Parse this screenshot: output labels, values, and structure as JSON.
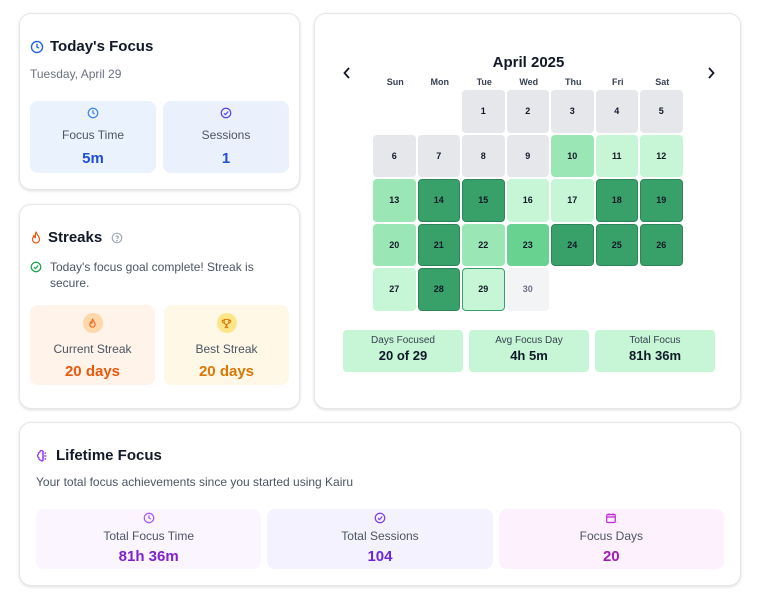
{
  "today": {
    "title": "Today's Focus",
    "date": "Tuesday, April 29",
    "focus_time_label": "Focus Time",
    "focus_time_value": "5m",
    "sessions_label": "Sessions",
    "sessions_value": "1"
  },
  "streaks": {
    "title": "Streaks",
    "status_text": "Today's focus goal complete! Streak is secure.",
    "current_label": "Current Streak",
    "current_value": "20 days",
    "best_label": "Best Streak",
    "best_value": "20 days"
  },
  "calendar": {
    "title": "April 2025",
    "prev_icon": "chevron-left-icon",
    "next_icon": "chevron-right-icon",
    "weekdays": [
      "Sun",
      "Mon",
      "Tue",
      "Wed",
      "Thu",
      "Fri",
      "Sat"
    ],
    "leading_blanks": 2,
    "days": [
      {
        "day": "1",
        "level": 0
      },
      {
        "day": "2",
        "level": 0
      },
      {
        "day": "3",
        "level": 0
      },
      {
        "day": "4",
        "level": 0
      },
      {
        "day": "5",
        "level": 0
      },
      {
        "day": "6",
        "level": 0
      },
      {
        "day": "7",
        "level": 0
      },
      {
        "day": "8",
        "level": 0
      },
      {
        "day": "9",
        "level": 0
      },
      {
        "day": "10",
        "level": 2
      },
      {
        "day": "11",
        "level": 1
      },
      {
        "day": "12",
        "level": 1
      },
      {
        "day": "13",
        "level": 2
      },
      {
        "day": "14",
        "level": 4
      },
      {
        "day": "15",
        "level": 4
      },
      {
        "day": "16",
        "level": 1
      },
      {
        "day": "17",
        "level": 1
      },
      {
        "day": "18",
        "level": 4
      },
      {
        "day": "19",
        "level": 4
      },
      {
        "day": "20",
        "level": 2
      },
      {
        "day": "21",
        "level": 4
      },
      {
        "day": "22",
        "level": 2
      },
      {
        "day": "23",
        "level": 3
      },
      {
        "day": "24",
        "level": 4
      },
      {
        "day": "25",
        "level": 4
      },
      {
        "day": "26",
        "level": 4
      },
      {
        "day": "27",
        "level": 1
      },
      {
        "day": "28",
        "level": 4
      },
      {
        "day": "29",
        "level": 1,
        "today": true
      },
      {
        "day": "30",
        "level": -1
      }
    ],
    "level_colors": {
      "future": "#f3f4f6",
      "0": "#e5e7eb",
      "1": "#c6f6d5",
      "2": "#9ae6b4",
      "3": "#68d391",
      "4": "#38a169"
    },
    "stats": [
      {
        "label": "Days Focused",
        "value": "20 of 29"
      },
      {
        "label": "Avg Focus Day",
        "value": "4h 5m"
      },
      {
        "label": "Total Focus",
        "value": "81h 36m"
      }
    ]
  },
  "lifetime": {
    "title": "Lifetime Focus",
    "subtitle": "Your total focus achievements since you started using Kairu",
    "total_time_label": "Total Focus Time",
    "total_time_value": "81h 36m",
    "total_sessions_label": "Total Sessions",
    "total_sessions_value": "104",
    "focus_days_label": "Focus Days",
    "focus_days_value": "20"
  }
}
